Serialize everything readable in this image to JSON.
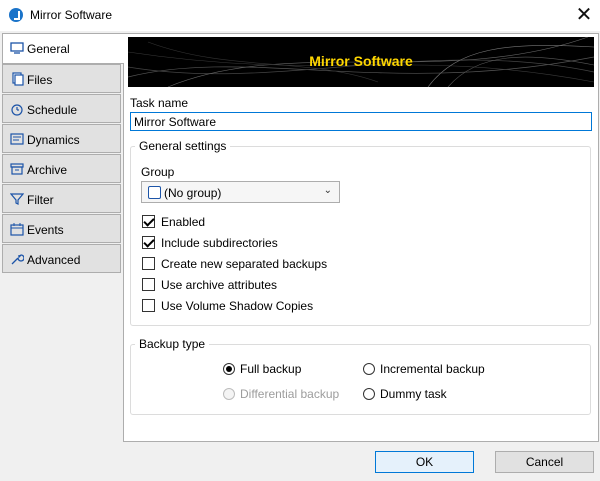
{
  "window": {
    "title": "Mirror Software",
    "close_glyph": "✕"
  },
  "tabs": [
    {
      "label": "General",
      "icon": "monitor-icon"
    },
    {
      "label": "Files",
      "icon": "files-icon"
    },
    {
      "label": "Schedule",
      "icon": "alarm-clock-icon"
    },
    {
      "label": "Dynamics",
      "icon": "dynamics-icon"
    },
    {
      "label": "Archive",
      "icon": "archive-icon"
    },
    {
      "label": "Filter",
      "icon": "filter-icon"
    },
    {
      "label": "Events",
      "icon": "calendar-icon"
    },
    {
      "label": "Advanced",
      "icon": "wrench-icon"
    }
  ],
  "banner": {
    "title": "Mirror Software"
  },
  "task_name": {
    "label": "Task name",
    "value": "Mirror Software"
  },
  "general_settings": {
    "legend": "General settings",
    "group_label": "Group",
    "group_value": "(No group)",
    "checkboxes": [
      {
        "label": "Enabled",
        "checked": true
      },
      {
        "label": "Include subdirectories",
        "checked": true
      },
      {
        "label": "Create new separated backups",
        "checked": false
      },
      {
        "label": "Use archive attributes",
        "checked": false
      },
      {
        "label": "Use Volume Shadow Copies",
        "checked": false
      }
    ]
  },
  "backup_type": {
    "legend": "Backup type",
    "options": [
      {
        "label": "Full backup",
        "selected": true,
        "disabled": false
      },
      {
        "label": "Incremental backup",
        "selected": false,
        "disabled": false
      },
      {
        "label": "Differential backup",
        "selected": false,
        "disabled": true
      },
      {
        "label": "Dummy task",
        "selected": false,
        "disabled": false
      }
    ]
  },
  "buttons": {
    "ok": "OK",
    "cancel": "Cancel"
  },
  "colors": {
    "accent": "#0078d7",
    "banner_text": "#ffd700",
    "icon_blue": "#1c54a8"
  }
}
